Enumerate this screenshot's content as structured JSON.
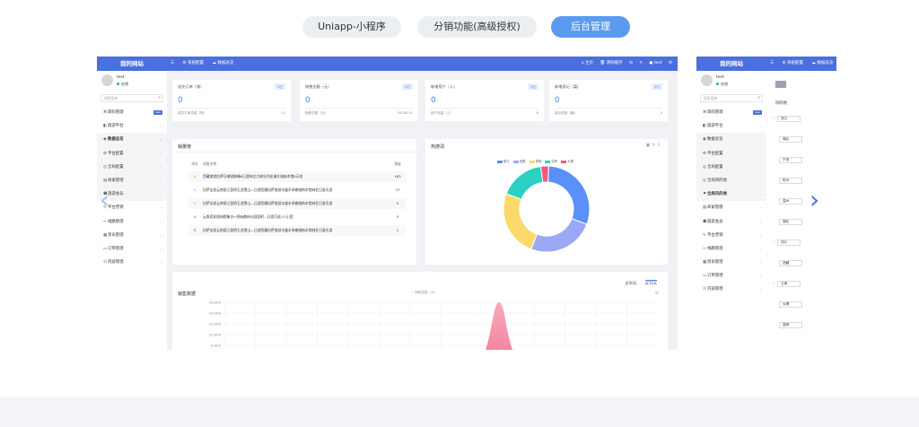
{
  "tabs": [
    {
      "label": "Uniapp-小程序",
      "active": false
    },
    {
      "label": "分销功能(高级授权)",
      "active": false
    },
    {
      "label": "后台管理",
      "active": true
    }
  ],
  "colors": {
    "accent": "#5a9bf0",
    "header": "#4a6fe0",
    "stat_value": "#4a86e8"
  },
  "main_slide": {
    "site_title": "我的网站",
    "header_tools": [
      "系统配置",
      "数据总览"
    ],
    "header_right": [
      "主页",
      "清除缓存",
      "test"
    ],
    "user": {
      "name": "test",
      "status": "在线"
    },
    "search_placeholder": "搜索菜单",
    "menu": [
      {
        "label": "简码管理",
        "icon": "code-icon",
        "badge": "new"
      },
      {
        "label": "旅游平台",
        "icon": "bag-icon"
      },
      {
        "label": "数据总览",
        "icon": "car-icon",
        "sub": true,
        "selected": true
      },
      {
        "label": "平台配置",
        "icon": "gear-icon",
        "sub": true
      },
      {
        "label": "全局配置",
        "icon": "globe-icon",
        "sub": true
      },
      {
        "label": "商家管理",
        "icon": "store-icon",
        "sub": true
      },
      {
        "label": "旅游会员",
        "icon": "user-icon",
        "sub": true
      },
      {
        "label": "平台营销",
        "icon": "pen-icon"
      },
      {
        "label": "线路管理",
        "icon": "route-icon"
      },
      {
        "label": "资讯管理",
        "icon": "doc-icon"
      },
      {
        "label": "订单管理",
        "icon": "folder-icon"
      },
      {
        "label": "内容管理",
        "icon": "list-icon"
      }
    ],
    "stats": [
      {
        "title": "成交订单（笔）",
        "badge": "今日",
        "value": "0",
        "foot_label": "成交订单总量（笔）",
        "foot_value": "11"
      },
      {
        "title": "销售金额（元）",
        "badge": "今日",
        "value": "0",
        "foot_label": "销售总额（元）",
        "foot_value": "20290.01"
      },
      {
        "title": "新增用户（人）",
        "badge": "今日",
        "value": "0",
        "foot_label": "用户总量（人）",
        "foot_value": "6"
      },
      {
        "title": "新增游记（篇）",
        "badge": "今日",
        "value": "0",
        "foot_label": "游记总数（篇）",
        "foot_value": "3"
      }
    ],
    "ranking": {
      "title": "销量榜",
      "columns": [
        "排名",
        "线路名称",
        "销量"
      ],
      "rows": [
        {
          "rank": "crown-gold",
          "name": "西藏旅游拉萨日喀则珠峰6日游林芝大峡谷巴松措羊湖纳木错6天游",
          "sales": "183"
        },
        {
          "rank": "crown-silver",
          "name": "拉萨出发云南丽江昆明玉龙雪山—日游西藏拉萨旅游丰盛羊卓雍措纳木错林芝日游天游",
          "sales": "17"
        },
        {
          "rank": "crown-bronze",
          "name": "拉萨出发云南丽江昆明玉龙雪山—日游西藏拉萨旅游丰盛羊卓雍措纳木错林芝日游天游",
          "sales": "5"
        },
        {
          "rank": "4",
          "name": "云南西双版纳野象谷+原始森林公园昆明—日游可送1人小团",
          "sales": "3"
        },
        {
          "rank": "5",
          "name": "拉萨出发云南丽江昆明玉龙雪山—日游西藏拉萨旅游丰盛羊卓雍措纳木错林芝日游天游",
          "sales": "1"
        }
      ]
    },
    "hot_words": {
      "title": "热搜词",
      "legend": [
        {
          "name": "丽江",
          "color": "#5b8ff9"
        },
        {
          "name": "西藏",
          "color": "#9aa8f5"
        },
        {
          "name": "昆明",
          "color": "#fbd96a"
        },
        {
          "name": "拉萨",
          "color": "#2bd1c3"
        },
        {
          "name": "大理",
          "color": "#f15b7d"
        }
      ],
      "values": [
        30,
        25,
        25,
        17,
        3
      ]
    },
    "sales": {
      "title": "销售数据",
      "range_buttons": [
        "近30天",
        "近15天"
      ],
      "series_name": "销售金额（元）",
      "y_ticks": [
        "16,000",
        "14,000",
        "12,000",
        "10,000",
        "8,000",
        "6,000",
        "4,000"
      ]
    }
  },
  "side_slide": {
    "site_title": "我的网站",
    "header_tools": [
      "系统配置",
      "数据总览"
    ],
    "user": {
      "name": "test",
      "status": "在线"
    },
    "search_placeholder": "搜索菜单",
    "menu": [
      {
        "label": "简码管理",
        "icon": "code-icon",
        "badge": "new"
      },
      {
        "label": "旅游平台",
        "icon": "bag-icon"
      },
      {
        "label": "数据总览",
        "icon": "car-icon",
        "sub": true
      },
      {
        "label": "平台配置",
        "icon": "gear-icon",
        "sub": true
      },
      {
        "label": "全局配置",
        "icon": "globe-icon",
        "sub": true
      },
      {
        "label": "全局目的地",
        "icon": "globe-icon",
        "sub": true
      },
      {
        "label": "全局目的地",
        "icon": "pin-icon",
        "sub": true,
        "selected": true
      },
      {
        "label": "商家管理",
        "icon": "store-icon"
      },
      {
        "label": "旅游会员",
        "icon": "user-icon"
      },
      {
        "label": "平台营销",
        "icon": "pen-icon"
      },
      {
        "label": "线路管理",
        "icon": "route-icon"
      },
      {
        "label": "资讯管理",
        "icon": "doc-icon"
      },
      {
        "label": "订单管理",
        "icon": "folder-icon"
      },
      {
        "label": "内容管理",
        "icon": "list-icon"
      }
    ],
    "content_title": "目的地",
    "tree": [
      "浙江",
      "湖北",
      "宁波",
      "杭州",
      "温州",
      "湖北",
      "四川",
      "西藏",
      "云南",
      "大理",
      "昆明"
    ]
  }
}
